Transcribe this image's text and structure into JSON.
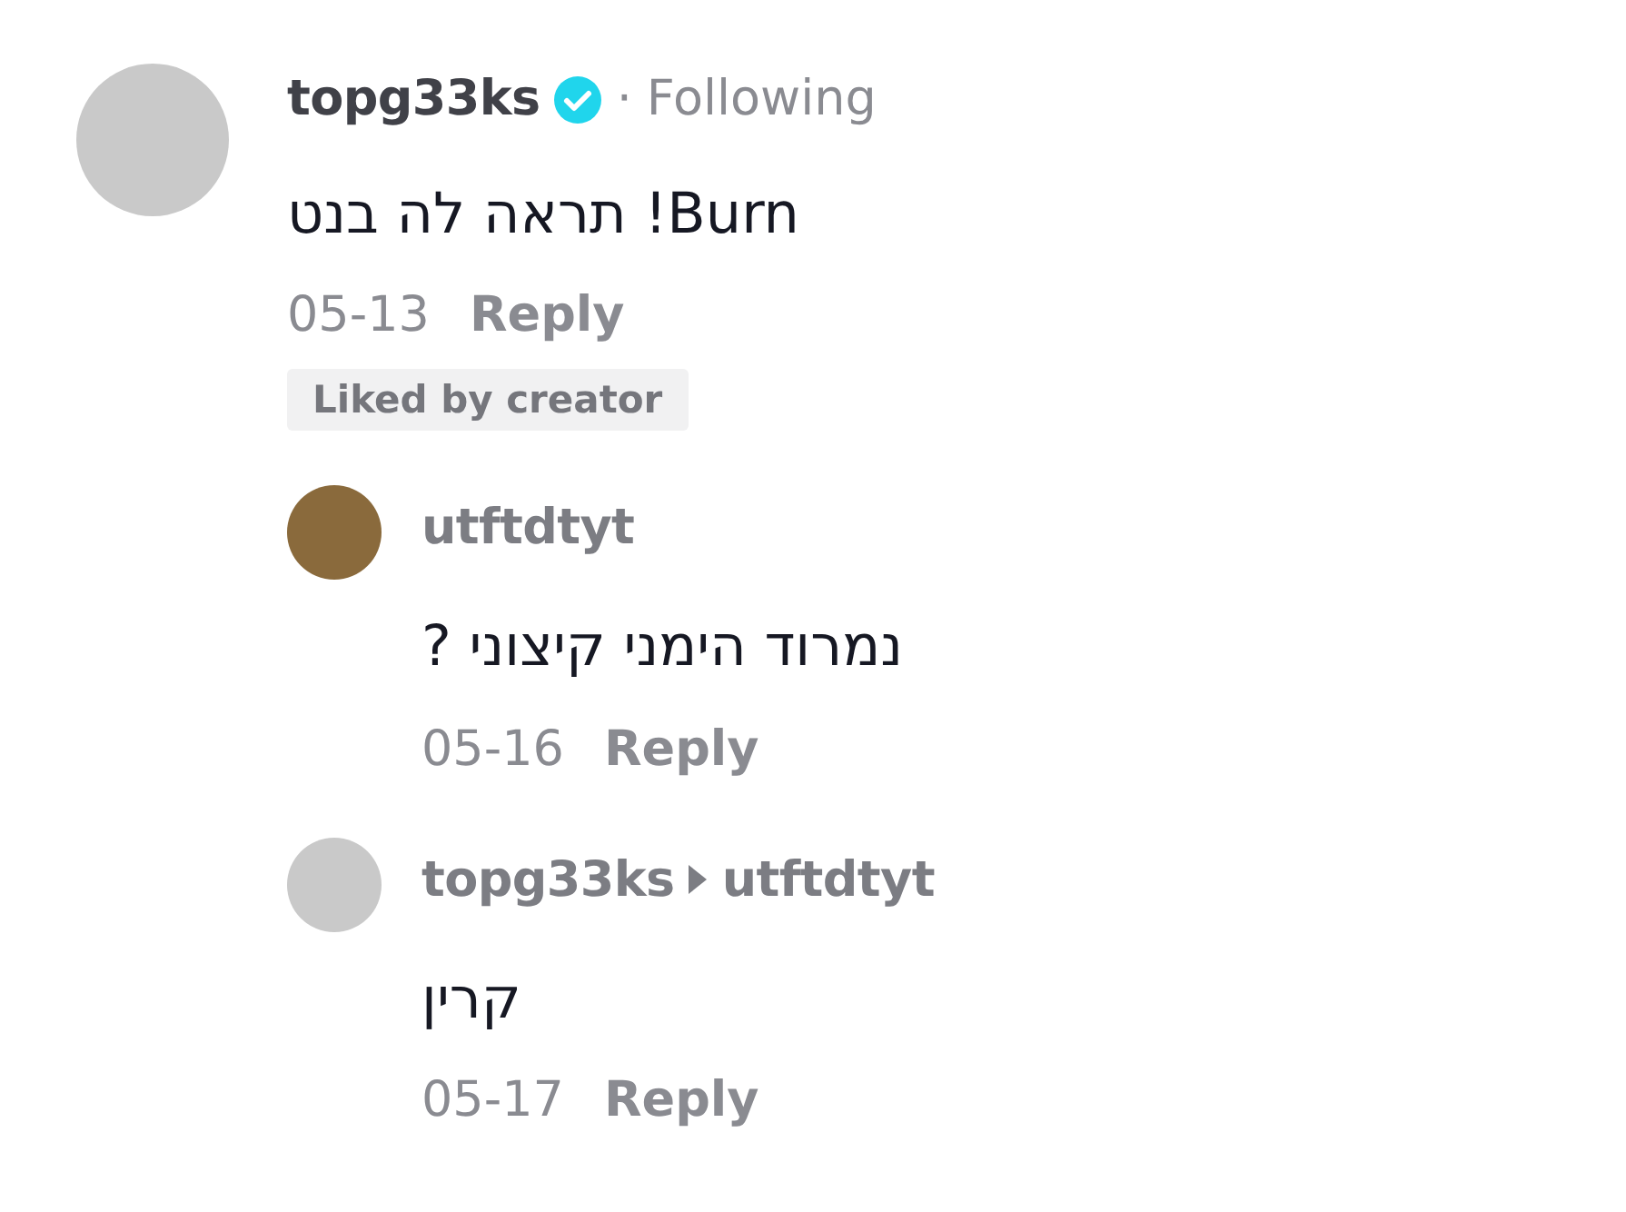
{
  "comment": {
    "author": "topg33ks",
    "verified": true,
    "separator": "·",
    "relation": "Following",
    "text": "Burn! תראה לה בנט",
    "date": "05-13",
    "reply_label": "Reply",
    "badge": "Liked by creator",
    "replies": [
      {
        "author": "utftdtyt",
        "text": "נמרוד הימני קיצוני ?",
        "date": "05-16",
        "reply_label": "Reply"
      },
      {
        "author": "topg33ks",
        "reply_to": "utftdtyt",
        "text": "קרין",
        "date": "05-17",
        "reply_label": "Reply"
      }
    ]
  }
}
